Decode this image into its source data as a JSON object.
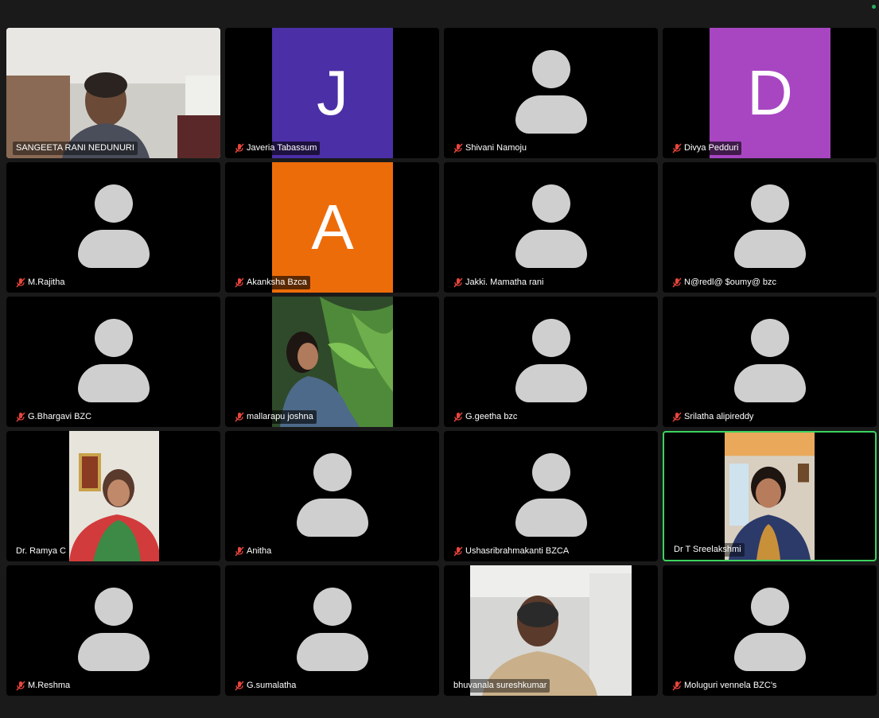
{
  "participants": [
    {
      "name": "SANGEETA RANI NEDUNURI",
      "muted": false,
      "video": "photo-woman-room"
    },
    {
      "name": "Javeria Tabassum",
      "muted": true,
      "initial": "J",
      "color": "#4b2fa6"
    },
    {
      "name": "Shivani Namoju",
      "muted": true
    },
    {
      "name": "Divya Pedduri",
      "muted": true,
      "initial": "D",
      "color": "#a846c2"
    },
    {
      "name": "M.Rajitha",
      "muted": true
    },
    {
      "name": "Akanksha Bzca",
      "muted": true,
      "initial": "A",
      "color": "#ed6c0a"
    },
    {
      "name": "Jakki. Mamatha rani",
      "muted": true
    },
    {
      "name": "N@redl@ $oumy@ bzc",
      "muted": true
    },
    {
      "name": "G.Bhargavi BZC",
      "muted": true
    },
    {
      "name": "mallarapu joshna",
      "muted": true,
      "video": "photo-woman-plants"
    },
    {
      "name": "G.geetha bzc",
      "muted": true
    },
    {
      "name": "Srilatha alipireddy",
      "muted": true
    },
    {
      "name": "Dr. Ramya C",
      "muted": false,
      "video": "photo-woman-saree"
    },
    {
      "name": "Anitha",
      "muted": true
    },
    {
      "name": "Ushasribrahmakanti BZCA",
      "muted": true
    },
    {
      "name": "Dr T Sreelakshmi",
      "muted": false,
      "active_speaker": true,
      "video": "photo-woman-speaking"
    },
    {
      "name": "M.Reshma",
      "muted": true
    },
    {
      "name": "G.sumalatha",
      "muted": true
    },
    {
      "name": "bhuvanala sureshkumar",
      "muted": false,
      "video": "photo-man"
    },
    {
      "name": "Moluguri vennela BZC's",
      "muted": true
    }
  ],
  "colors": {
    "active_border": "#3dd35f",
    "mute_icon": "#e8453c",
    "avatar": "#cfcfcf"
  }
}
